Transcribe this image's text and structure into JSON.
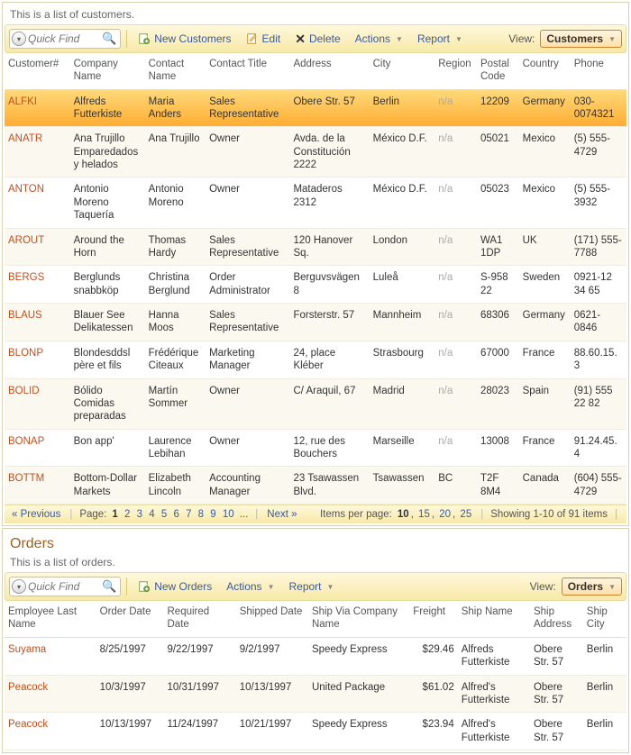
{
  "customers": {
    "desc": "This is a list of customers.",
    "quickFindPlaceholder": "Quick Find",
    "toolbar": {
      "new": "New Customers",
      "edit": "Edit",
      "delete": "Delete",
      "actions": "Actions",
      "report": "Report",
      "viewLabel": "View:",
      "viewValue": "Customers"
    },
    "columns": [
      "Customer#",
      "Company Name",
      "Contact Name",
      "Contact Title",
      "Address",
      "City",
      "Region",
      "Postal Code",
      "Country",
      "Phone"
    ],
    "rows": [
      {
        "id": "ALFKI",
        "company": "Alfreds Futterkiste",
        "contact": "Maria Anders",
        "title": "Sales Representative",
        "address": "Obere Str. 57",
        "city": "Berlin",
        "region": "n/a",
        "postal": "12209",
        "country": "Germany",
        "phone": "030-0074321",
        "selected": true
      },
      {
        "id": "ANATR",
        "company": "Ana Trujillo Emparedados y helados",
        "contact": "Ana Trujillo",
        "title": "Owner",
        "address": "Avda. de la Constitución 2222",
        "city": "México D.F.",
        "region": "n/a",
        "postal": "05021",
        "country": "Mexico",
        "phone": "(5) 555-4729"
      },
      {
        "id": "ANTON",
        "company": "Antonio Moreno Taquería",
        "contact": "Antonio Moreno",
        "title": "Owner",
        "address": "Mataderos 2312",
        "city": "México D.F.",
        "region": "n/a",
        "postal": "05023",
        "country": "Mexico",
        "phone": "(5) 555-3932"
      },
      {
        "id": "AROUT",
        "company": "Around the Horn",
        "contact": "Thomas Hardy",
        "title": "Sales Representative",
        "address": "120 Hanover Sq.",
        "city": "London",
        "region": "n/a",
        "postal": "WA1 1DP",
        "country": "UK",
        "phone": "(171) 555-7788"
      },
      {
        "id": "BERGS",
        "company": "Berglunds snabbköp",
        "contact": "Christina Berglund",
        "title": "Order Administrator",
        "address": "Berguvsvägen 8",
        "city": "Luleå",
        "region": "n/a",
        "postal": "S-958 22",
        "country": "Sweden",
        "phone": "0921-12 34 65"
      },
      {
        "id": "BLAUS",
        "company": "Blauer See Delikatessen",
        "contact": "Hanna Moos",
        "title": "Sales Representative",
        "address": "Forsterstr. 57",
        "city": "Mannheim",
        "region": "n/a",
        "postal": "68306",
        "country": "Germany",
        "phone": "0621-0846"
      },
      {
        "id": "BLONP",
        "company": "Blondesddsl père et fils",
        "contact": "Frédérique Citeaux",
        "title": "Marketing Manager",
        "address": "24, place Kléber",
        "city": "Strasbourg",
        "region": "n/a",
        "postal": "67000",
        "country": "France",
        "phone": "88.60.15.3"
      },
      {
        "id": "BOLID",
        "company": "Bólido Comidas preparadas",
        "contact": "Martín Sommer",
        "title": "Owner",
        "address": "C/ Araquil, 67",
        "city": "Madrid",
        "region": "n/a",
        "postal": "28023",
        "country": "Spain",
        "phone": "(91) 555 22 82"
      },
      {
        "id": "BONAP",
        "company": "Bon app'",
        "contact": "Laurence Lebihan",
        "title": "Owner",
        "address": "12, rue des Bouchers",
        "city": "Marseille",
        "region": "n/a",
        "postal": "13008",
        "country": "France",
        "phone": "91.24.45.4"
      },
      {
        "id": "BOTTM",
        "company": "Bottom-Dollar Markets",
        "contact": "Elizabeth Lincoln",
        "title": "Accounting Manager",
        "address": "23 Tsawassen Blvd.",
        "city": "Tsawassen",
        "region": "BC",
        "postal": "T2F 8M4",
        "country": "Canada",
        "phone": "(604) 555-4729"
      }
    ],
    "pager": {
      "prev": "« Previous",
      "pageLabel": "Page:",
      "pages": [
        "1",
        "2",
        "3",
        "4",
        "5",
        "6",
        "7",
        "8",
        "9",
        "10"
      ],
      "current": "1",
      "more": "...",
      "next": "Next »",
      "ippLabel": "Items per page:",
      "ipp": [
        "10",
        "15",
        "20",
        "25"
      ],
      "ippCurrent": "10",
      "showing": "Showing 1-10 of 91 items"
    }
  },
  "orders": {
    "title": "Orders",
    "desc": "This is a list of orders.",
    "quickFindPlaceholder": "Quick Find",
    "toolbar": {
      "new": "New Orders",
      "actions": "Actions",
      "report": "Report",
      "viewLabel": "View:",
      "viewValue": "Orders"
    },
    "columns": [
      "Employee Last Name",
      "Order Date",
      "Required Date",
      "Shipped Date",
      "Ship Via Company Name",
      "Freight",
      "Ship Name",
      "Ship Address",
      "Ship City"
    ],
    "rows": [
      {
        "emp": "Suyama",
        "od": "8/25/1997",
        "rd": "9/22/1997",
        "sd": "9/2/1997",
        "via": "Speedy Express",
        "freight": "$29.46",
        "sname": "Alfreds Futterkiste",
        "saddr": "Obere Str. 57",
        "scity": "Berlin"
      },
      {
        "emp": "Peacock",
        "od": "10/3/1997",
        "rd": "10/31/1997",
        "sd": "10/13/1997",
        "via": "United Package",
        "freight": "$61.02",
        "sname": "Alfred's Futterkiste",
        "saddr": "Obere Str. 57",
        "scity": "Berlin"
      },
      {
        "emp": "Peacock",
        "od": "10/13/1997",
        "rd": "11/24/1997",
        "sd": "10/21/1997",
        "via": "Speedy Express",
        "freight": "$23.94",
        "sname": "Alfred's Futterkiste",
        "saddr": "Obere Str. 57",
        "scity": "Berlin"
      }
    ]
  }
}
